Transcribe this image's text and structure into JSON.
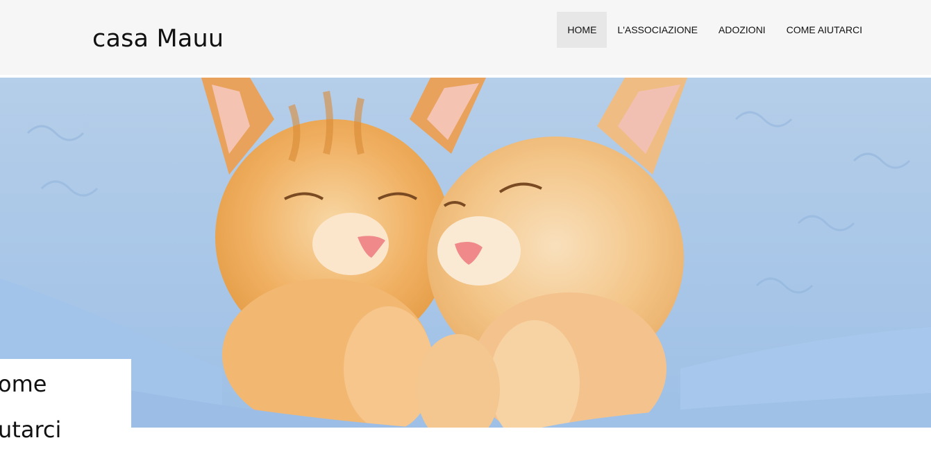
{
  "header": {
    "site_title": "casa Mauu",
    "nav": [
      {
        "label": "HOME",
        "active": true
      },
      {
        "label": "L'ASSOCIAZIONE",
        "active": false
      },
      {
        "label": "ADOZIONI",
        "active": false
      },
      {
        "label": "COME AIUTARCI",
        "active": false
      }
    ]
  },
  "hero": {
    "image": "photo-two-sleeping-ginger-kittens-blue-blanket"
  },
  "caption": {
    "line1": "ome",
    "line2": "utarci"
  },
  "colors": {
    "header_bg": "#f6f6f7",
    "nav_active_bg": "#e7e7e8",
    "blanket": "#a9c6e6",
    "kitten": "#f0b26a"
  }
}
